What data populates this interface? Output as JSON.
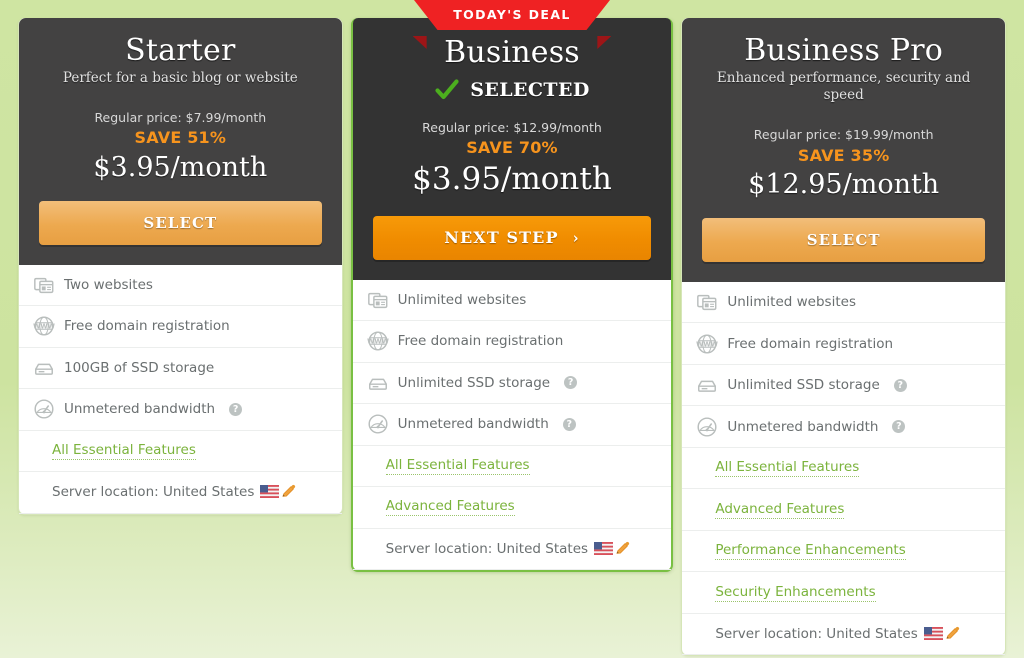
{
  "theme": {
    "page_bg": "#cde3a0",
    "card_header_bg": "#434242",
    "featured_header_bg": "#333333",
    "featured_border": "#79c043",
    "ribbon_bg": "#ef2223",
    "save_color": "#f7941d",
    "cta_select_color": "#eda94f",
    "cta_next_color": "#f08c00",
    "link_green": "#7bb33c",
    "check_green": "#4caf1e"
  },
  "ribbon": {
    "label": "TODAY'S DEAL"
  },
  "plans": [
    {
      "id": "starter",
      "name": "Starter",
      "tagline": "Perfect for a basic blog or website",
      "featured": false,
      "selected": false,
      "regular_price": "Regular price: $7.99/month",
      "save": "SAVE 51%",
      "price": "$3.95/month",
      "cta_label": "SELECT",
      "features": [
        {
          "icon": "websites-icon",
          "text": "Two websites",
          "help": false,
          "type": "item"
        },
        {
          "icon": "www-globe-icon",
          "text": "Free domain registration",
          "help": false,
          "type": "item"
        },
        {
          "icon": "ssd-storage-icon",
          "text": "100GB of SSD storage",
          "help": false,
          "type": "item"
        },
        {
          "icon": "bandwidth-gauge-icon",
          "text": "Unmetered bandwidth",
          "help": true,
          "type": "item"
        },
        {
          "icon": "",
          "text": "All Essential Features",
          "help": false,
          "type": "link"
        },
        {
          "icon": "",
          "text": "Server location: United States",
          "help": false,
          "type": "location"
        }
      ]
    },
    {
      "id": "business",
      "name": "Business",
      "tagline": "",
      "featured": true,
      "selected": true,
      "selected_label": "SELECTED",
      "regular_price": "Regular price: $12.99/month",
      "save": "SAVE 70%",
      "price": "$3.95/month",
      "cta_label": "NEXT STEP",
      "cta_chevron": "›",
      "features": [
        {
          "icon": "websites-icon",
          "text": "Unlimited websites",
          "help": false,
          "type": "item"
        },
        {
          "icon": "www-globe-icon",
          "text": "Free domain registration",
          "help": false,
          "type": "item"
        },
        {
          "icon": "ssd-storage-icon",
          "text": "Unlimited SSD storage",
          "help": true,
          "type": "item"
        },
        {
          "icon": "bandwidth-gauge-icon",
          "text": "Unmetered bandwidth",
          "help": true,
          "type": "item"
        },
        {
          "icon": "",
          "text": "All Essential Features",
          "help": false,
          "type": "link"
        },
        {
          "icon": "",
          "text": "Advanced Features",
          "help": false,
          "type": "link"
        },
        {
          "icon": "",
          "text": "Server location: United States",
          "help": false,
          "type": "location"
        }
      ]
    },
    {
      "id": "business-pro",
      "name": "Business Pro",
      "tagline": "Enhanced performance, security and speed",
      "featured": false,
      "selected": false,
      "regular_price": "Regular price: $19.99/month",
      "save": "SAVE 35%",
      "price": "$12.95/month",
      "cta_label": "SELECT",
      "features": [
        {
          "icon": "websites-icon",
          "text": "Unlimited websites",
          "help": false,
          "type": "item"
        },
        {
          "icon": "www-globe-icon",
          "text": "Free domain registration",
          "help": false,
          "type": "item"
        },
        {
          "icon": "ssd-storage-icon",
          "text": "Unlimited SSD storage",
          "help": true,
          "type": "item"
        },
        {
          "icon": "bandwidth-gauge-icon",
          "text": "Unmetered bandwidth",
          "help": true,
          "type": "item"
        },
        {
          "icon": "",
          "text": "All Essential Features",
          "help": false,
          "type": "link"
        },
        {
          "icon": "",
          "text": "Advanced Features",
          "help": false,
          "type": "link"
        },
        {
          "icon": "",
          "text": "Performance Enhancements",
          "help": false,
          "type": "link"
        },
        {
          "icon": "",
          "text": "Security Enhancements",
          "help": false,
          "type": "link"
        },
        {
          "icon": "",
          "text": "Server location: United States",
          "help": false,
          "type": "location"
        }
      ]
    }
  ],
  "help_glyph": "?"
}
